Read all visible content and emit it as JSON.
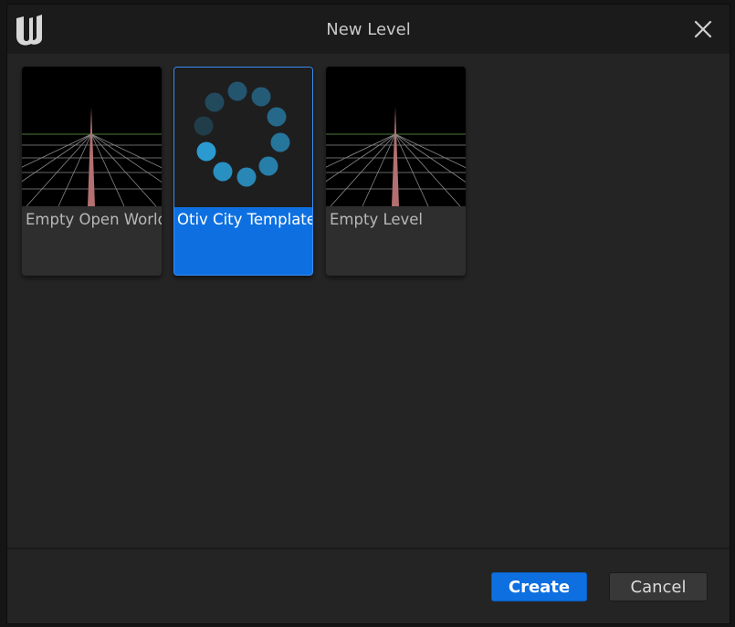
{
  "window": {
    "title": "New Level"
  },
  "templates": [
    {
      "label": "Empty Open World",
      "selected": false
    },
    {
      "label": "Otiv City Template",
      "selected": true
    },
    {
      "label": "Empty Level",
      "selected": false
    }
  ],
  "footer": {
    "create_label": "Create",
    "cancel_label": "Cancel"
  },
  "colors": {
    "accent": "#0e70e0",
    "background": "#242424",
    "titlebar": "#1b1b1b"
  }
}
